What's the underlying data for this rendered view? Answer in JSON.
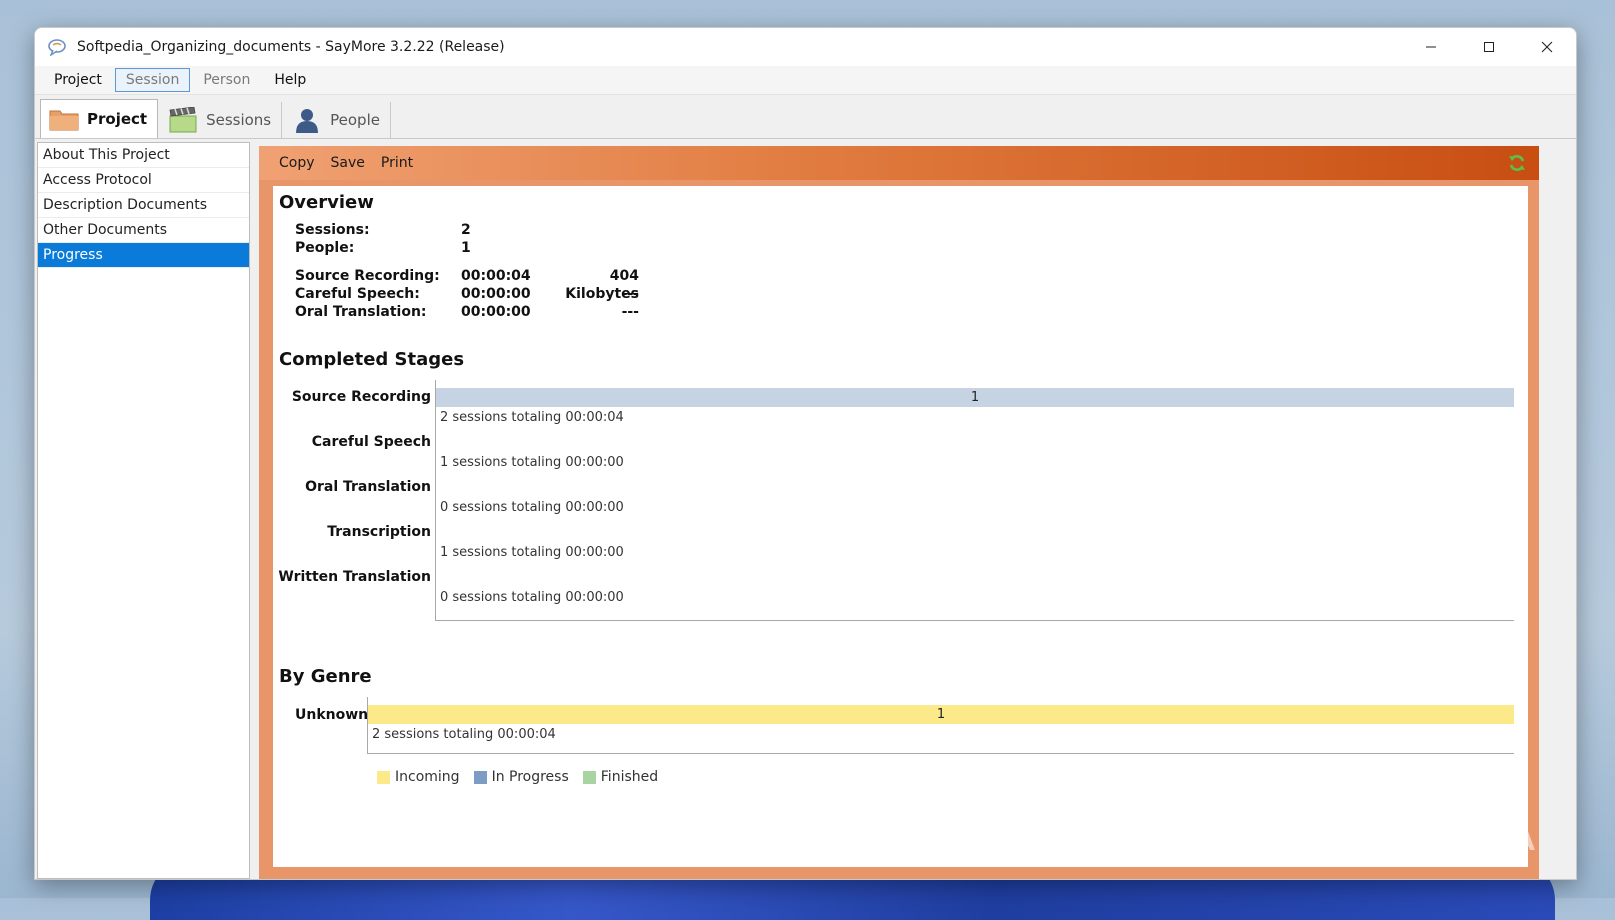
{
  "window": {
    "title": "Softpedia_Organizing_documents - SayMore 3.2.22 (Release)"
  },
  "menu": [
    {
      "label": "Project",
      "state": "normal"
    },
    {
      "label": "Session",
      "state": "selected"
    },
    {
      "label": "Person",
      "state": "muted"
    },
    {
      "label": "Help",
      "state": "normal"
    }
  ],
  "tabs": [
    {
      "label": "Project",
      "icon": "folder-icon",
      "active": true
    },
    {
      "label": "Sessions",
      "icon": "clapperboard-icon",
      "active": false
    },
    {
      "label": "People",
      "icon": "person-icon",
      "active": false
    }
  ],
  "sidebar": {
    "items": [
      "About This Project",
      "Access Protocol",
      "Description Documents",
      "Other Documents",
      "Progress"
    ],
    "selected": "Progress"
  },
  "toolbar": {
    "copy_label": "Copy",
    "save_label": "Save",
    "print_label": "Print",
    "refresh_icon": "refresh-icon"
  },
  "overview": {
    "title": "Overview",
    "sessions_label": "Sessions:",
    "sessions_value": "2",
    "people_label": "People:",
    "people_value": "1",
    "source_label": "Source Recording:",
    "source_time": "00:00:04",
    "source_size": "404 Kilobytes",
    "careful_label": "Careful Speech:",
    "careful_time": "00:00:00",
    "careful_size": "---",
    "oral_label": "Oral Translation:",
    "oral_time": "00:00:00",
    "oral_size": "---"
  },
  "completed_stages": {
    "title": "Completed Stages",
    "stages": [
      {
        "label": "Source Recording",
        "bar_value": 1,
        "bar_label": "1",
        "summary": "2 sessions totaling 00:00:04"
      },
      {
        "label": "Careful Speech",
        "bar_value": 0,
        "bar_label": "",
        "summary": "1 sessions totaling 00:00:00"
      },
      {
        "label": "Oral Translation",
        "bar_value": 0,
        "bar_label": "",
        "summary": "0 sessions totaling 00:00:00"
      },
      {
        "label": "Transcription",
        "bar_value": 0,
        "bar_label": "",
        "summary": "1 sessions totaling 00:00:00"
      },
      {
        "label": "Written Translation",
        "bar_value": 0,
        "bar_label": "",
        "summary": "0 sessions totaling 00:00:00"
      }
    ],
    "bar_color": "#c6d3e3"
  },
  "by_genre": {
    "title": "By Genre",
    "genre_label": "Unknown",
    "bar_value": 1,
    "bar_label": "1",
    "summary": "2 sessions totaling 00:00:04",
    "bar_color": "#fbe98a"
  },
  "legend": [
    {
      "label": "Incoming",
      "color": "#fbe98a"
    },
    {
      "label": "In Progress",
      "color": "#7d9cc4"
    },
    {
      "label": "Finished",
      "color": "#a7d4a0"
    }
  ],
  "colors": {
    "accent_orange": "#e07a3e",
    "selection_blue": "#0a7bd8"
  },
  "watermark": "SOFTPEDIA"
}
